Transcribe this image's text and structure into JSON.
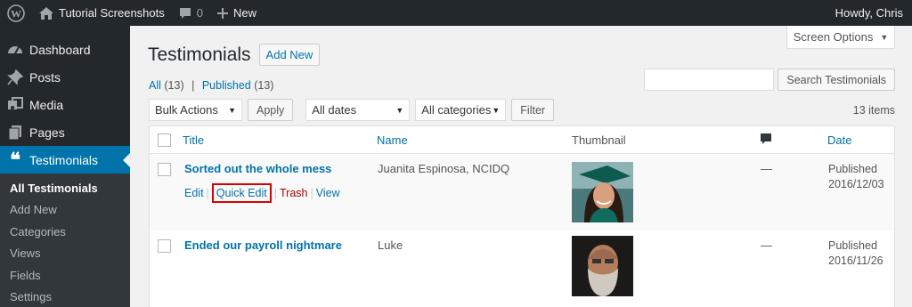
{
  "adminbar": {
    "site_name": "Tutorial Screenshots",
    "comments_count": "0",
    "new_label": "New",
    "greeting": "Howdy, Chris"
  },
  "sidebar": {
    "items": [
      {
        "label": "Dashboard",
        "icon": "dashboard-icon"
      },
      {
        "label": "Posts",
        "icon": "pin-icon"
      },
      {
        "label": "Media",
        "icon": "media-icon"
      },
      {
        "label": "Pages",
        "icon": "pages-icon"
      },
      {
        "label": "Testimonials",
        "icon": "quote-icon"
      }
    ],
    "submenu": [
      "All Testimonials",
      "Add New",
      "Categories",
      "Views",
      "Fields",
      "Settings"
    ]
  },
  "main": {
    "screen_options": "Screen Options",
    "title": "Testimonials",
    "add_new": "Add New",
    "filters": {
      "all": "All",
      "all_count": "(13)",
      "separator": "|",
      "published": "Published",
      "published_count": "(13)"
    },
    "search_button": "Search Testimonials",
    "bulk_actions": "Bulk Actions",
    "apply": "Apply",
    "all_dates": "All dates",
    "all_categories": "All categories",
    "filter": "Filter",
    "items_count": "13 items",
    "columns": {
      "title": "Title",
      "name": "Name",
      "thumbnail": "Thumbnail",
      "date": "Date"
    },
    "rows": [
      {
        "title": "Sorted out the whole mess",
        "name": "Juanita Espinosa, NCIDQ",
        "comments": "—",
        "status": "Published",
        "date": "2016/12/03",
        "actions": {
          "edit": "Edit",
          "quick_edit": "Quick Edit",
          "trash": "Trash",
          "view": "View",
          "sep": "|"
        }
      },
      {
        "title": "Ended our payroll nightmare",
        "name": "Luke",
        "comments": "—",
        "status": "Published",
        "date": "2016/11/26"
      }
    ]
  },
  "colors": {
    "admin_dark": "#23282d",
    "accent": "#0073aa",
    "trash": "#a00",
    "highlight_box": "#d00"
  }
}
